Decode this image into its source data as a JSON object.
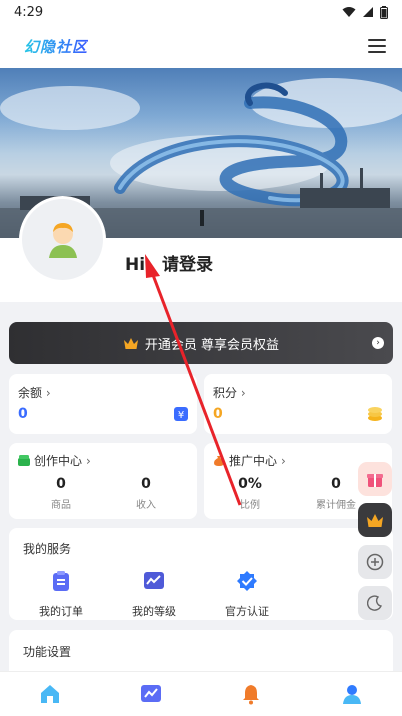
{
  "status_bar": {
    "time": "4:29"
  },
  "header": {
    "logo_text": "幻隐社区",
    "menu_icon": "menu-icon"
  },
  "profile": {
    "greeting": "Hi，请登录"
  },
  "vip": {
    "label": "开通会员 尊享会员权益"
  },
  "balance": {
    "title": "余额",
    "value": "0"
  },
  "points": {
    "title": "积分",
    "value": "0"
  },
  "creation": {
    "title": "创作中心",
    "stats": [
      {
        "value": "0",
        "label": "商品"
      },
      {
        "value": "0",
        "label": "收入"
      }
    ]
  },
  "promotion": {
    "title": "推广中心",
    "stats": [
      {
        "value": "0%",
        "label": "比例"
      },
      {
        "value": "0",
        "label": "累计佣金"
      }
    ]
  },
  "services": {
    "title": "我的服务",
    "items": [
      {
        "label": "我的订单",
        "icon": "clipboard-icon"
      },
      {
        "label": "我的等级",
        "icon": "chart-icon"
      },
      {
        "label": "官方认证",
        "icon": "verified-icon"
      }
    ]
  },
  "settings": {
    "title": "功能设置"
  },
  "colors": {
    "accent": "#3a6cff",
    "orange": "#f5a623",
    "dark_vip": "#333336"
  }
}
